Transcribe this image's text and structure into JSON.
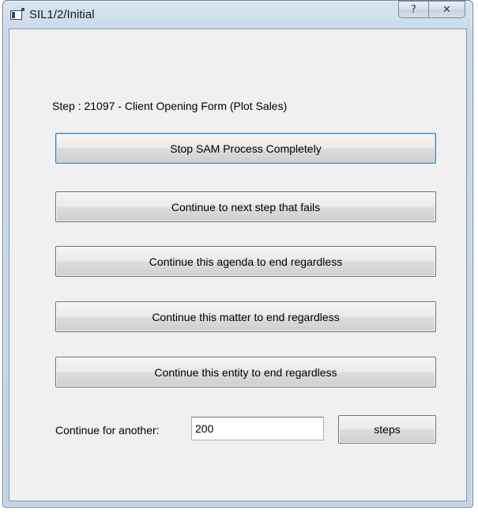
{
  "window": {
    "title": "SIL1/2/Initial",
    "help_glyph": "?",
    "close_glyph": "✕"
  },
  "form": {
    "step_label": "Step : 21097 - Client Opening Form (Plot Sales)",
    "buttons": [
      {
        "label": "Stop SAM Process Completely"
      },
      {
        "label": "Continue to next step that fails"
      },
      {
        "label": "Continue this agenda to end regardless"
      },
      {
        "label": "Continue this matter to end regardless"
      },
      {
        "label": "Continue this entity to end regardless"
      }
    ],
    "continue_label": "Continue for another:",
    "steps_value": "200",
    "steps_button": "steps"
  }
}
